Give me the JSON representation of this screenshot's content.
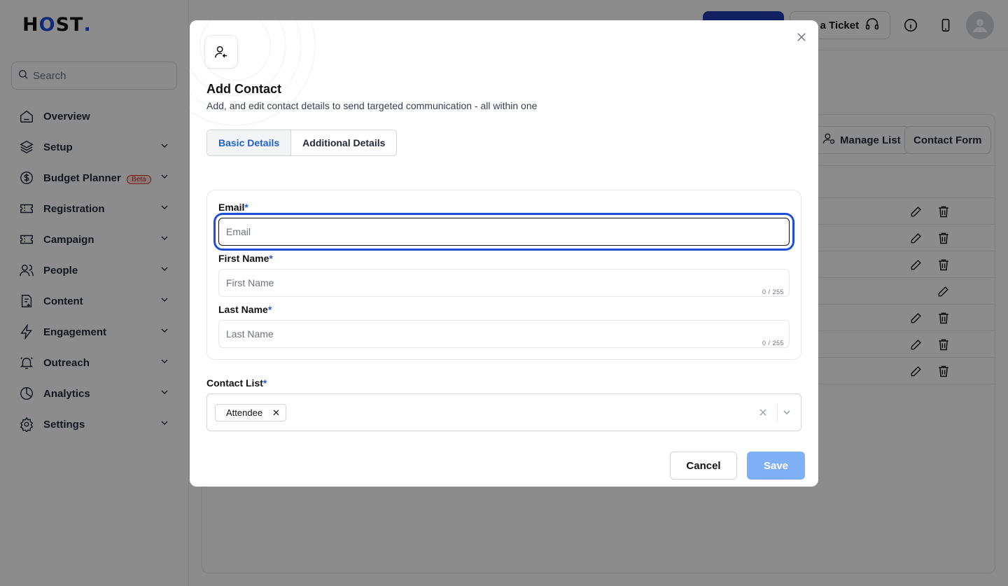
{
  "brand": {
    "logo_h": "H",
    "logo_o": "O",
    "logo_rest": "ST",
    "logo_dot": "."
  },
  "sidebar": {
    "search_placeholder": "Search",
    "items": [
      {
        "label": "Overview",
        "icon": "home-icon"
      },
      {
        "label": "Setup",
        "icon": "layers-icon"
      },
      {
        "label": "Budget Planner",
        "icon": "dollar-icon",
        "badge": "Beta"
      },
      {
        "label": "Registration",
        "icon": "ticket-icon"
      },
      {
        "label": "Campaign",
        "icon": "ticket-icon"
      },
      {
        "label": "People",
        "icon": "users-icon"
      },
      {
        "label": "Content",
        "icon": "document-plus-icon"
      },
      {
        "label": "Engagement",
        "icon": "lightning-icon"
      },
      {
        "label": "Outreach",
        "icon": "bell-icon"
      },
      {
        "label": "Analytics",
        "icon": "pie-chart-icon"
      },
      {
        "label": "Settings",
        "icon": "gear-icon"
      }
    ]
  },
  "topbar": {
    "ticket_label": "e a Ticket"
  },
  "background": {
    "manage_list_label": "Manage List",
    "contact_form_label": "Contact Form"
  },
  "modal": {
    "title": "Add Contact",
    "subtitle": "Add, and edit contact details to send targeted communication - all within one",
    "tabs": [
      {
        "label": "Basic Details",
        "active": true
      },
      {
        "label": "Additional Details",
        "active": false
      }
    ],
    "email": {
      "label": "Email",
      "required": "*",
      "placeholder": "Email",
      "value": ""
    },
    "first_name": {
      "label": "First Name",
      "required": "*",
      "placeholder": "First Name",
      "value": "",
      "counter": "0 / 255"
    },
    "last_name": {
      "label": "Last Name",
      "required": "*",
      "placeholder": "Last Name",
      "value": "",
      "counter": "0 / 255"
    },
    "contact_list": {
      "label": "Contact List",
      "required": "*",
      "selected": [
        "Attendee"
      ]
    },
    "cancel_label": "Cancel",
    "save_label": "Save"
  },
  "colors": {
    "accent": "#1d4ed8",
    "save_disabled": "#7fb0f5",
    "overlay": "rgba(0,0,0,0.45)"
  }
}
